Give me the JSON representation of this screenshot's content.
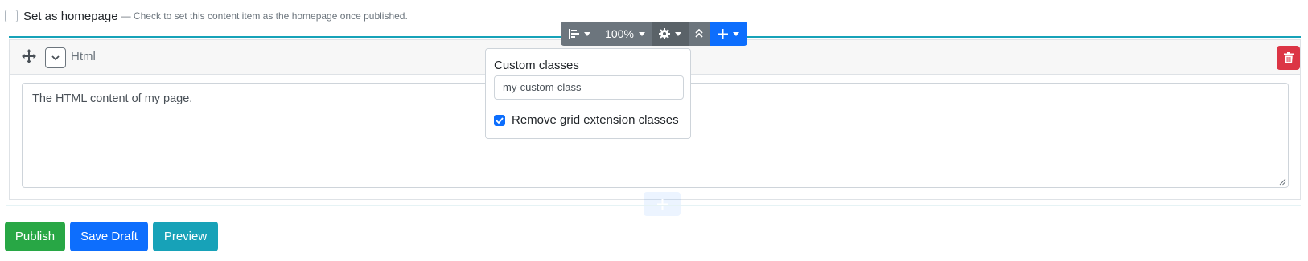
{
  "homepage": {
    "label": "Set as homepage",
    "hint": "— Check to set this content item as the homepage once published.",
    "checked": false
  },
  "widget": {
    "title": "Html",
    "content": "The HTML content of my page.",
    "icons": [
      "move-icon",
      "chevron-down-icon",
      "trash-icon"
    ]
  },
  "toolbar": {
    "zoom": "100%",
    "icons": [
      "align-left-icon",
      "gear-icon",
      "double-chevron-up-icon",
      "plus-icon"
    ]
  },
  "settings_popover": {
    "custom_classes_label": "Custom classes",
    "custom_classes_value": "my-custom-class",
    "remove_grid_label": "Remove grid extension classes",
    "remove_grid_checked": true
  },
  "actions": {
    "publish": "Publish",
    "save_draft": "Save Draft",
    "preview": "Preview"
  },
  "colors": {
    "primary": "#0d6efd",
    "success": "#28a745",
    "info": "#17a2b8",
    "danger": "#dc3545",
    "secondary": "#6c757d"
  }
}
